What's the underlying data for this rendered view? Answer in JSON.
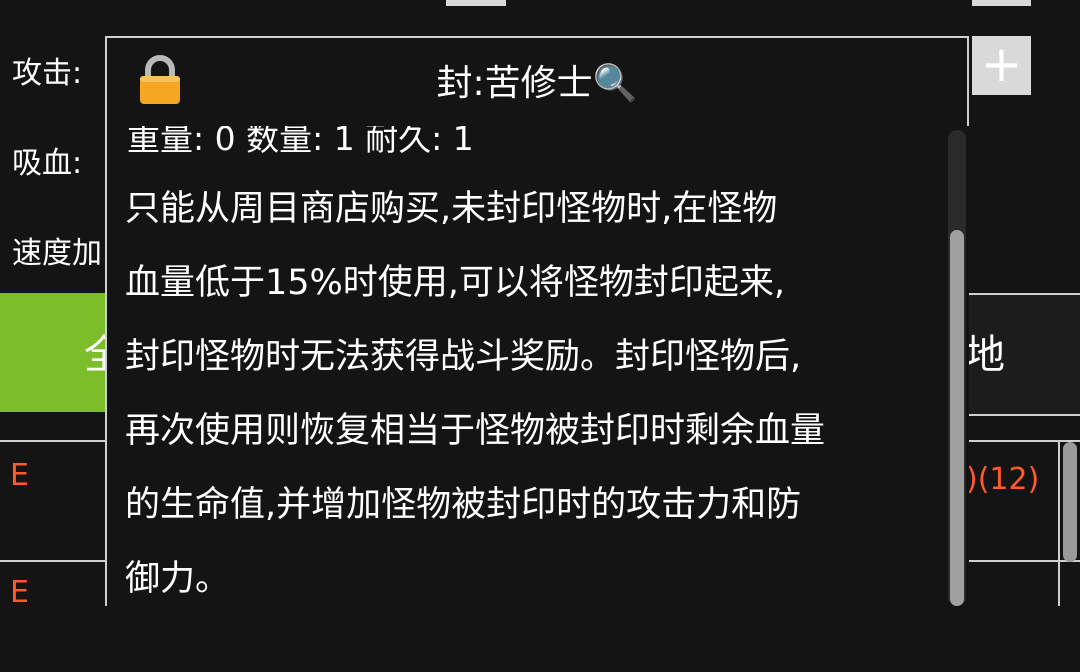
{
  "background": {
    "stats": {
      "attack_label": "攻击:",
      "lifesteal_label": "吸血:",
      "speed_label": "速度加"
    },
    "plus_button": "+",
    "green_button_fragment": "全",
    "right_button_fragment": "地",
    "rows": [
      {
        "letter": "E",
        "value": ")(12)"
      },
      {
        "letter": "E"
      }
    ]
  },
  "dialog": {
    "title": "封:苦修士🔍",
    "stats_line": "重量: 0 数量: 1 耐久: 1",
    "description_lines": [
      "只能从周目商店购买,未封印怪物时,在怪物",
      "血量低于15%时使用,可以将怪物封印起来,",
      "封印怪物时无法获得战斗奖励。封印怪物后,",
      "再次使用则恢复相当于怪物被封印时剩余血量",
      "的生命值,并增加怪物被封印时的攻击力和防",
      "御力。"
    ]
  },
  "colors": {
    "background": "#141414",
    "accent_green": "#7cbd2a",
    "row_text_red": "#ff5a2a",
    "border": "#cfcfcf"
  }
}
